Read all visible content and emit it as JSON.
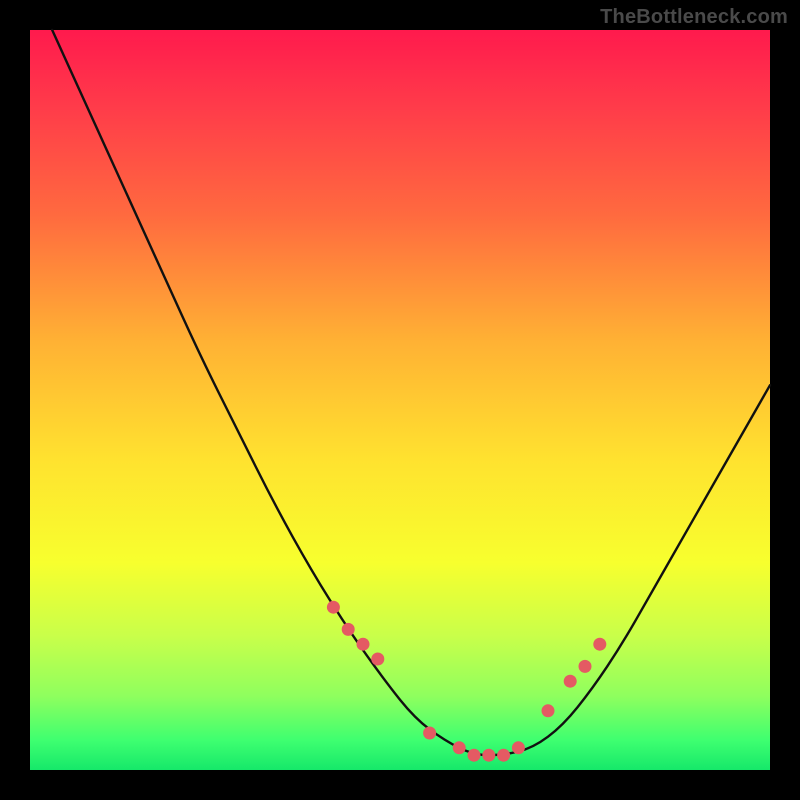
{
  "watermark": "TheBottleneck.com",
  "colors": {
    "gradient_top": "#ff1a4d",
    "gradient_mid": "#ffe22f",
    "gradient_bottom": "#16e86a",
    "curve_stroke": "#111111",
    "marker_fill": "#e45a63",
    "frame_bg": "#000000"
  },
  "chart_data": {
    "type": "line",
    "title": "",
    "xlabel": "",
    "ylabel": "",
    "xlim": [
      0,
      100
    ],
    "ylim": [
      0,
      100
    ],
    "grid": false,
    "legend": false,
    "series": [
      {
        "name": "bottleneck-curve",
        "x": [
          3,
          8,
          13,
          18,
          23,
          28,
          33,
          38,
          43,
          48,
          52,
          56,
          60,
          64,
          68,
          72,
          76,
          80,
          84,
          88,
          92,
          96,
          100
        ],
        "y": [
          100,
          89,
          78,
          67,
          56,
          46,
          36,
          27,
          19,
          12,
          7,
          4,
          2,
          2,
          3,
          6,
          11,
          17,
          24,
          31,
          38,
          45,
          52
        ]
      }
    ],
    "markers": {
      "name": "highlighted-points",
      "x": [
        41,
        43,
        45,
        47,
        54,
        58,
        60,
        62,
        64,
        66,
        70,
        73,
        75,
        77
      ],
      "y": [
        22,
        19,
        17,
        15,
        5,
        3,
        2,
        2,
        2,
        3,
        8,
        12,
        14,
        17
      ]
    }
  }
}
